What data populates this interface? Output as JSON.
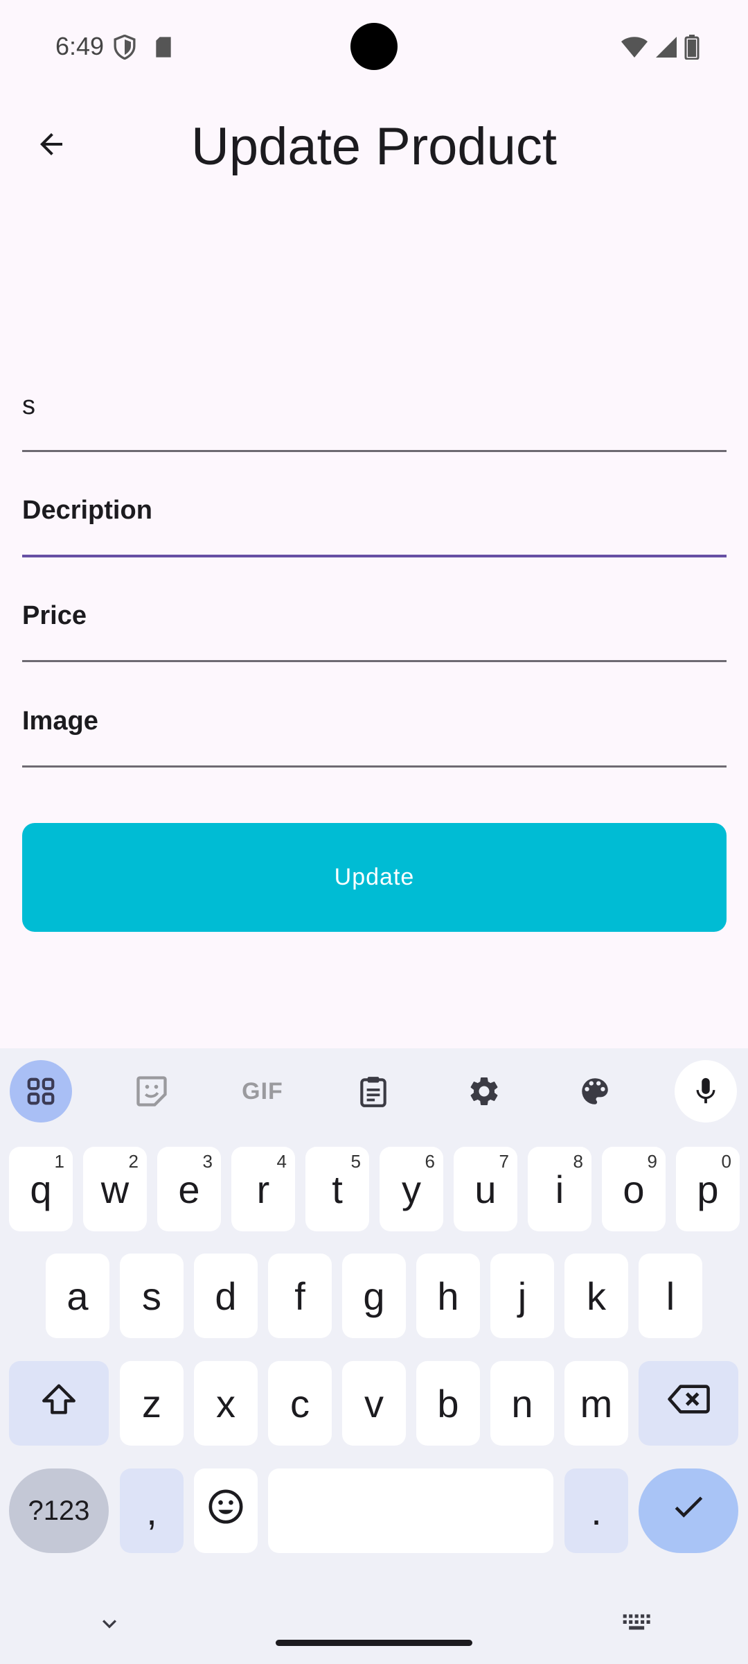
{
  "status_bar": {
    "time": "6:49"
  },
  "app_bar": {
    "title": "Update Product",
    "back_icon": "arrow-back-icon"
  },
  "form": {
    "name_value": "s",
    "description_label": "Decription",
    "price_label": "Price",
    "image_label": "Image",
    "update_label": "Update"
  },
  "colors": {
    "accent": "#00bcd4",
    "focus": "#6750a4",
    "background": "#fdf7fd"
  },
  "keyboard": {
    "toolbar": [
      "apps-icon",
      "sticker-icon",
      "GIF",
      "clipboard-icon",
      "settings-icon",
      "palette-icon",
      "mic-icon"
    ],
    "gif_label": "GIF",
    "row1": [
      "q",
      "w",
      "e",
      "r",
      "t",
      "y",
      "u",
      "i",
      "o",
      "p"
    ],
    "row1_sup": [
      "1",
      "2",
      "3",
      "4",
      "5",
      "6",
      "7",
      "8",
      "9",
      "0"
    ],
    "row2": [
      "a",
      "s",
      "d",
      "f",
      "g",
      "h",
      "j",
      "k",
      "l"
    ],
    "row3": [
      "z",
      "x",
      "c",
      "v",
      "b",
      "n",
      "m"
    ],
    "sym_label": "?123",
    "comma": ",",
    "period": "."
  }
}
